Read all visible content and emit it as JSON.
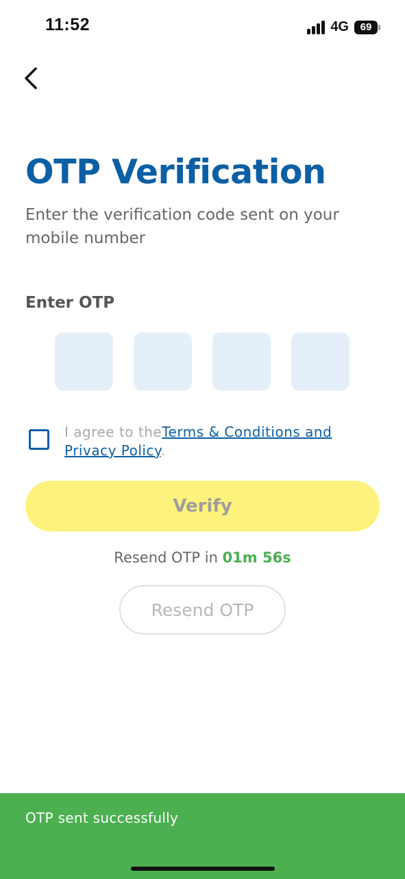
{
  "status_bar": {
    "time": "11:52",
    "network": "4G",
    "battery": "69"
  },
  "header": {
    "back_icon": "chevron-left-icon"
  },
  "title": "OTP Verification",
  "subtitle": "Enter the verification code sent on your mobile number",
  "otp": {
    "label": "Enter OTP",
    "digits": [
      "",
      "",
      "",
      ""
    ]
  },
  "agreement": {
    "prefix": "I agree to the",
    "link_text": "Terms & Conditions and Privacy Policy",
    "suffix": "."
  },
  "verify_button": {
    "label": "Verify"
  },
  "resend": {
    "prefix": "Resend OTP in ",
    "countdown": "01m 56s",
    "button_label": "Resend OTP"
  },
  "toast": {
    "message": "OTP sent successfully"
  },
  "colors": {
    "primary": "#0b5fa5",
    "verify_bg": "#fdf27c",
    "success": "#4caf50",
    "otp_box_bg": "#e4eff9"
  }
}
